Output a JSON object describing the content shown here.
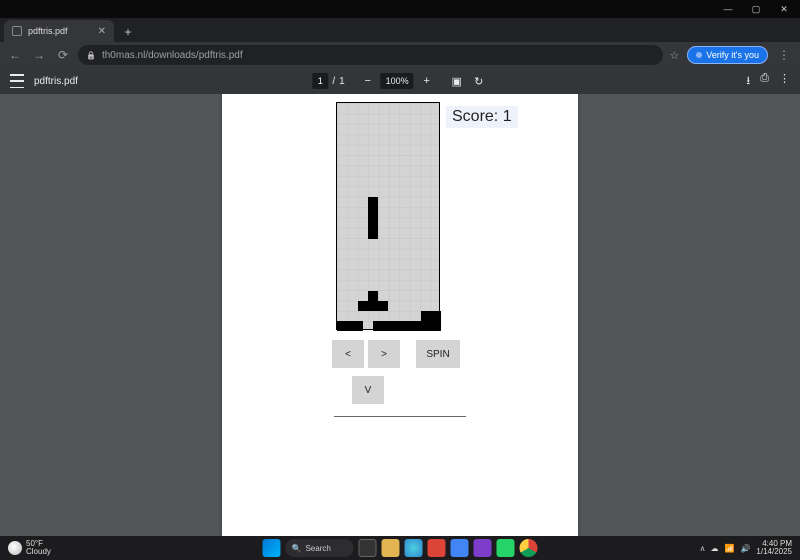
{
  "window": {
    "min": "—",
    "max": "▢",
    "close": "✕"
  },
  "tab": {
    "title": "pdftris.pdf",
    "close": "✕"
  },
  "nav": {
    "back": "←",
    "fwd": "→",
    "reload": "⟳"
  },
  "url": "th0mas.nl/downloads/pdftris.pdf",
  "verify": "Verify it's you",
  "pdf": {
    "filename": "pdftris.pdf",
    "page_cur": "1",
    "page_sep": "/",
    "page_total": "1",
    "zoom_out": "−",
    "zoom": "100%",
    "zoom_in": "+",
    "download": "⭳",
    "print": "⎙",
    "menu": "⋮"
  },
  "game": {
    "score_label": "Score:",
    "score": "1",
    "left": "<",
    "right": ">",
    "spin": "SPIN",
    "down": "V"
  },
  "taskbar": {
    "temp": "50°F",
    "cond": "Cloudy",
    "search_label": "Search",
    "tray": {
      "up": "ᴧ",
      "cloud": "☁",
      "wifi": "📶",
      "vol": "🔊",
      "time": "4:40 PM",
      "date": "1/14/2025"
    }
  },
  "colors": {
    "start": "#0078d4",
    "explorer": "#e2b552",
    "edge": "#2f88d0",
    "chrome1": "#db4437",
    "chrome2": "#4285f4",
    "store": "#7d3cc9",
    "wa": "#25d366",
    "chrome3": "#e37400"
  }
}
